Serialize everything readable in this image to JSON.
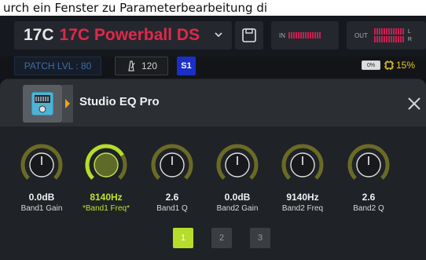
{
  "caption": "urch ein Fenster zu Parameterbearbeitung di",
  "preset": {
    "number": "17C",
    "name": "17C Powerball DS"
  },
  "meters": {
    "in_label": "IN",
    "out_label": "OUT",
    "left": "L",
    "right": "R"
  },
  "status": {
    "patch_level": "PATCH LVL : 80",
    "bpm": "120",
    "snapshot": "S1",
    "battery": "0%",
    "cpu": "15%"
  },
  "block": {
    "title": "Studio EQ Pro",
    "icon": "eq-pedal-icon"
  },
  "colors": {
    "accent": "#b6dd2c",
    "preset_name": "#e1284a",
    "knob_ring": "#6b6a26",
    "snapshot": "#1a2fc8"
  },
  "knobs": [
    {
      "value": "0.0dB",
      "label": "Band1 Gain",
      "level": 0.5,
      "active": false
    },
    {
      "value": "8140Hz",
      "label": "*Band1 Freq*",
      "level": 0.72,
      "active": true
    },
    {
      "value": "2.6",
      "label": "Band1 Q",
      "level": 0.5,
      "active": false
    },
    {
      "value": "0.0dB",
      "label": "Band2 Gain",
      "level": 0.5,
      "active": false
    },
    {
      "value": "9140Hz",
      "label": "Band2 Freq",
      "level": 0.5,
      "active": false
    },
    {
      "value": "2.6",
      "label": "Band2 Q",
      "level": 0.5,
      "active": false
    }
  ],
  "pages": [
    "1",
    "2",
    "3"
  ],
  "current_page": "1"
}
